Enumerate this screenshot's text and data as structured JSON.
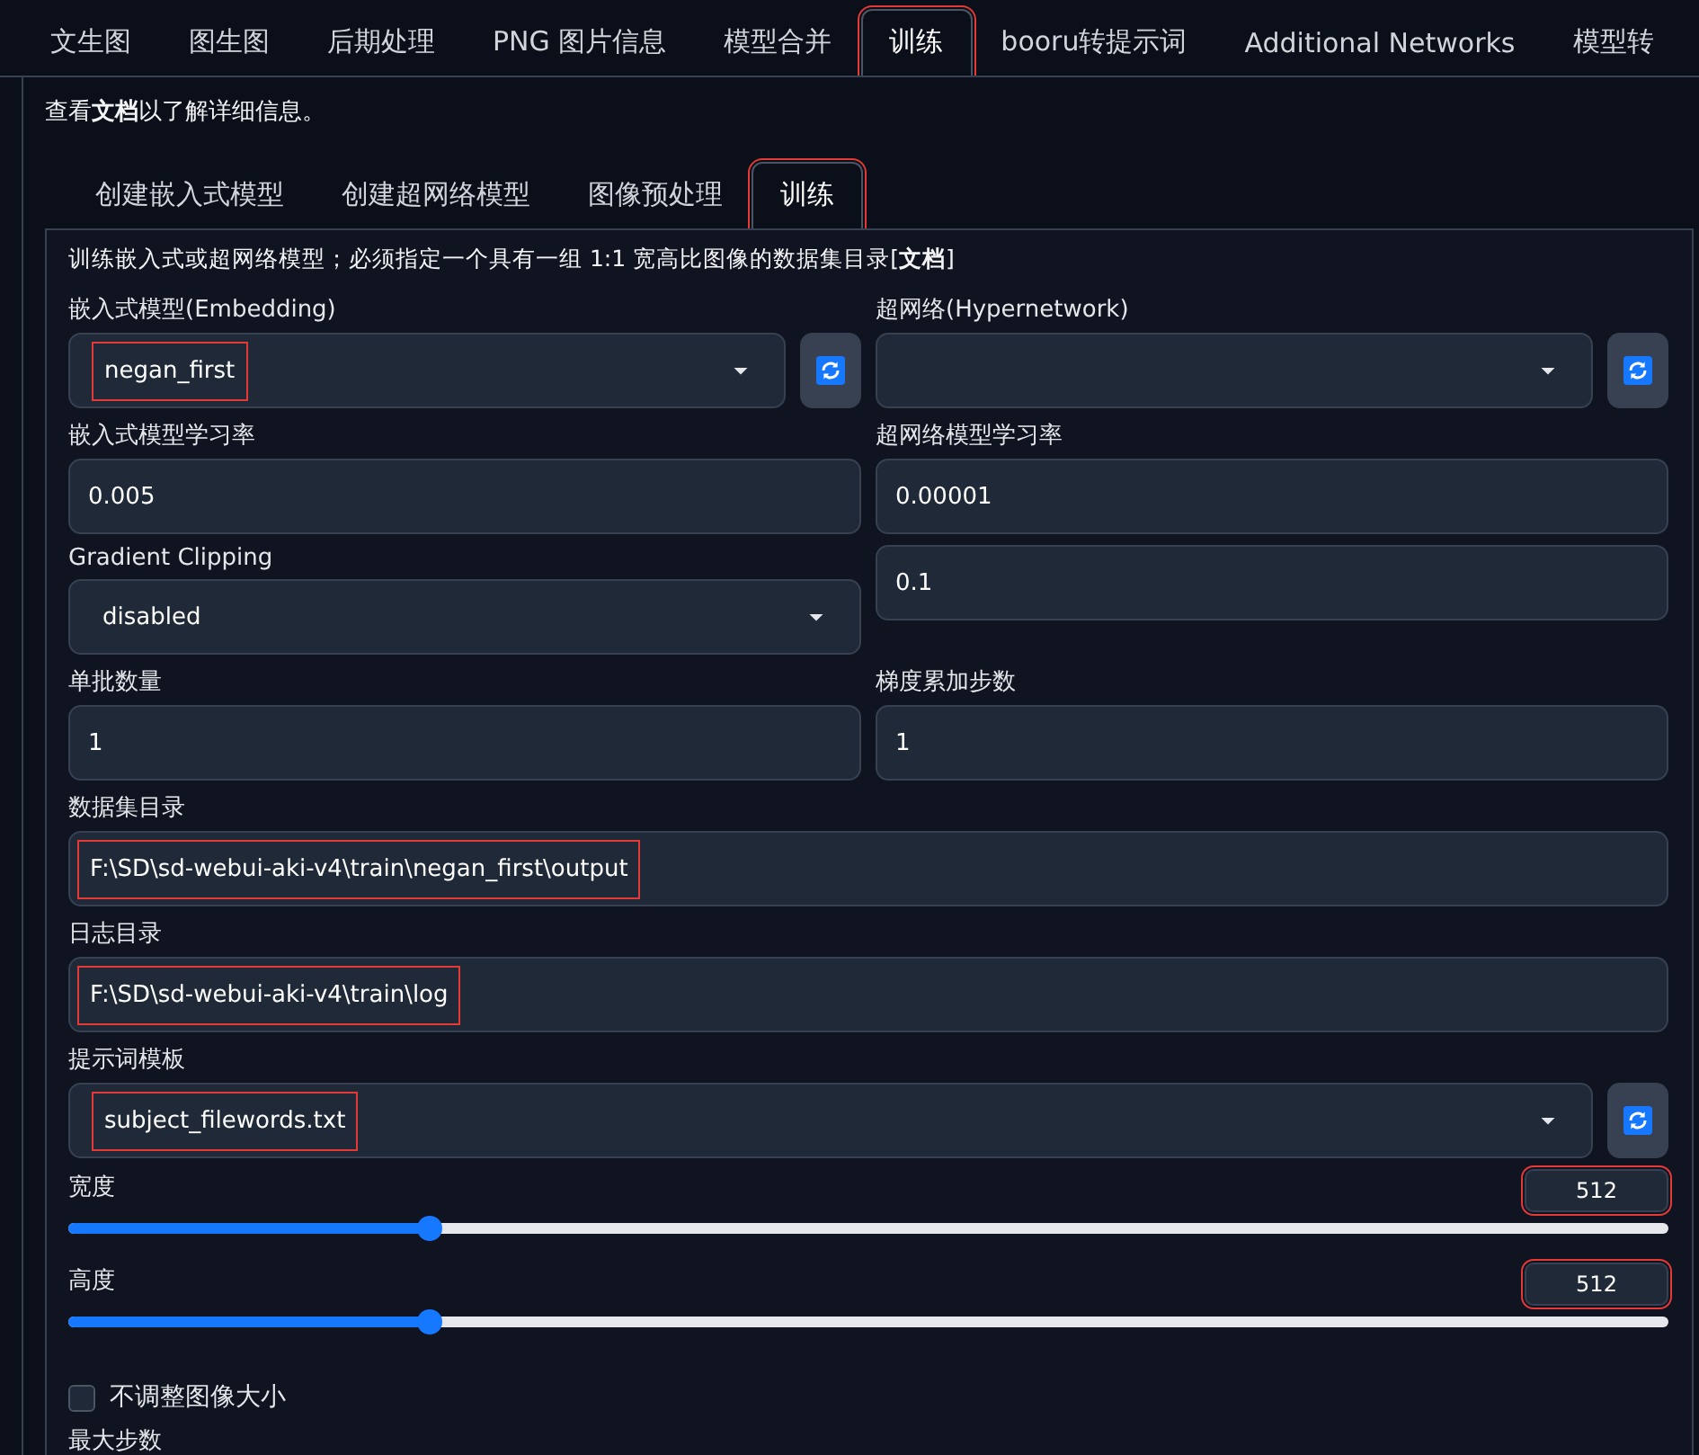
{
  "tabs": [
    {
      "label": "文生图",
      "selected": false,
      "highlighted": false
    },
    {
      "label": "图生图",
      "selected": false,
      "highlighted": false
    },
    {
      "label": "后期处理",
      "selected": false,
      "highlighted": false
    },
    {
      "label": "PNG 图片信息",
      "selected": false,
      "highlighted": false
    },
    {
      "label": "模型合并",
      "selected": false,
      "highlighted": false
    },
    {
      "label": "训练",
      "selected": true,
      "highlighted": true
    },
    {
      "label": "booru转提示词",
      "selected": false,
      "highlighted": false
    },
    {
      "label": "Additional Networks",
      "selected": false,
      "highlighted": false
    },
    {
      "label": "模型转",
      "selected": false,
      "highlighted": false
    }
  ],
  "notice": "查看**文档**以了解详细信息。",
  "sub_tabs": [
    {
      "label": "创建嵌入式模型",
      "selected": false,
      "highlighted": false
    },
    {
      "label": "创建超网络模型",
      "selected": false,
      "highlighted": false
    },
    {
      "label": "图像预处理",
      "selected": false,
      "highlighted": false
    },
    {
      "label": "训练",
      "selected": true,
      "highlighted": true
    }
  ],
  "description": "训练嵌入式或超网络模型；必须指定一个具有一组 1:1 宽高比图像的数据集目录[**文档**]",
  "rows": [
    {
      "fields": [
        {
          "kind": "dropdown_refresh",
          "label": "嵌入式模型(Embedding)",
          "value": "negan_first",
          "highlighted": true
        },
        {
          "kind": "dropdown_refresh",
          "label": "超网络(Hypernetwork)"
        }
      ]
    },
    {
      "fields": [
        {
          "kind": "text",
          "label": "嵌入式模型学习率",
          "value": "0.005",
          "highlighted": false
        },
        {
          "kind": "text",
          "label": "超网络模型学习率",
          "value": "0.00001",
          "highlighted": false
        }
      ]
    },
    {
      "fields": [
        {
          "kind": "dropdown",
          "label": "Gradient Clipping",
          "value": "disabled",
          "highlighted": false
        },
        {
          "kind": "text",
          "value": "0.1",
          "highlighted": false
        }
      ]
    },
    {
      "fields": [
        {
          "kind": "text",
          "label": "单批数量",
          "value": "1",
          "highlighted": false
        },
        {
          "kind": "text",
          "label": "梯度累加步数",
          "value": "1",
          "highlighted": false
        }
      ]
    },
    {
      "fields": [
        {
          "kind": "text",
          "label": "数据集目录",
          "value": "F:\\SD\\sd-webui-aki-v4\\train\\negan_first\\output",
          "highlighted": true
        }
      ]
    },
    {
      "fields": [
        {
          "kind": "text",
          "label": "日志目录",
          "value": "F:\\SD\\sd-webui-aki-v4\\train\\log",
          "highlighted": true
        }
      ]
    },
    {
      "fields": [
        {
          "kind": "dropdown_refresh",
          "label": "提示词模板",
          "value": "subject_filewords.txt",
          "highlighted": true
        }
      ]
    },
    {
      "fields": [
        {
          "kind": "slider",
          "label": "宽度",
          "value": "512",
          "level": 0.226,
          "highlighted": true
        }
      ]
    },
    {
      "fields": [
        {
          "kind": "slider",
          "label": "高度",
          "value": "512",
          "level": 0.226,
          "highlighted": true
        }
      ]
    },
    {
      "fields": [
        {
          "kind": "checkbox",
          "label": "不调整图像大小",
          "checked": false
        }
      ]
    },
    {
      "fields": [
        {
          "kind": "heading",
          "label": "最大步数"
        }
      ]
    }
  ]
}
